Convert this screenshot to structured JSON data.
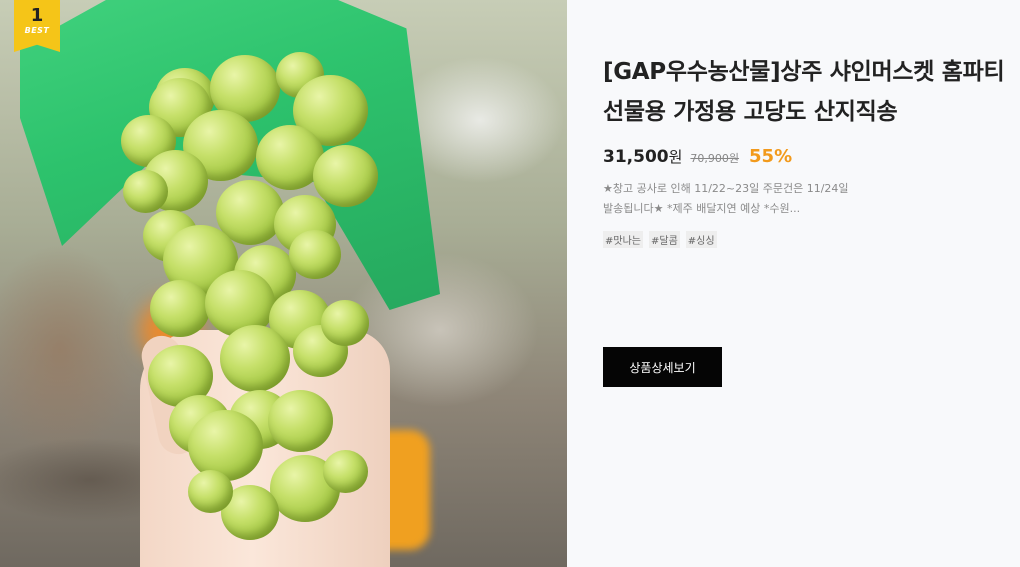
{
  "badge": {
    "rank": "1",
    "label": "BEST"
  },
  "product": {
    "title": "[GAP우수농산물]상주 샤인머스켓 홈파티 선물용 가정용 고당도 산지직송",
    "price": "31,500",
    "currency": "원",
    "original_price": "70,900원",
    "discount": "55%",
    "description": "★창고 공사로 인해 11/22~23일 주문건은 11/24일 발송됩니다★ *제주 배달지연 예상 *수원...",
    "tags": [
      "#맛나는",
      "#달콤",
      "#싱싱"
    ],
    "detail_button": "상품상세보기"
  },
  "colors": {
    "badge": "#f5c518",
    "discount": "#f29a1c",
    "button_bg": "#050505",
    "panel_bg": "#f8f9fb"
  }
}
